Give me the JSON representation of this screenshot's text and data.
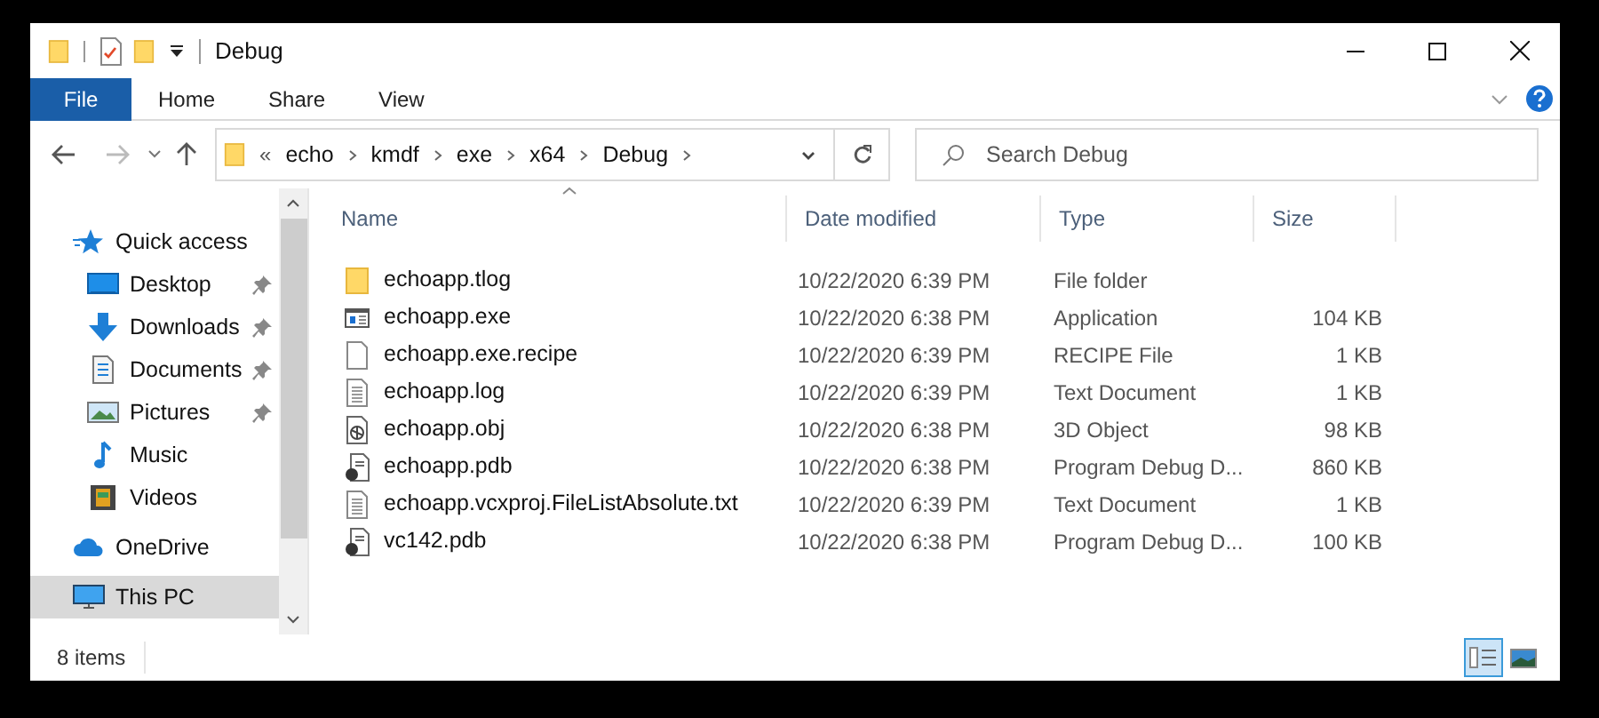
{
  "window": {
    "title": "Debug"
  },
  "ribbon": {
    "tabs": [
      {
        "label": "File",
        "selected": true
      },
      {
        "label": "Home",
        "selected": false
      },
      {
        "label": "Share",
        "selected": false
      },
      {
        "label": "View",
        "selected": false
      }
    ]
  },
  "address": {
    "overflow": "«",
    "crumbs": [
      "echo",
      "kmdf",
      "exe",
      "x64",
      "Debug"
    ]
  },
  "search": {
    "placeholder": "Search Debug"
  },
  "sidebar": {
    "items": [
      {
        "label": "Quick access",
        "kind": "star",
        "selected": false,
        "children": [
          {
            "label": "Desktop",
            "kind": "desktop",
            "pinned": true,
            "selected": false
          },
          {
            "label": "Downloads",
            "kind": "download",
            "pinned": true,
            "selected": false
          },
          {
            "label": "Documents",
            "kind": "document",
            "pinned": true,
            "selected": false
          },
          {
            "label": "Pictures",
            "kind": "picture",
            "pinned": true,
            "selected": false
          },
          {
            "label": "Music",
            "kind": "music",
            "pinned": false,
            "selected": false
          },
          {
            "label": "Videos",
            "kind": "video",
            "pinned": false,
            "selected": false
          }
        ]
      },
      {
        "label": "OneDrive",
        "kind": "cloud",
        "selected": false
      },
      {
        "label": "This PC",
        "kind": "pc",
        "selected": true
      }
    ]
  },
  "table": {
    "columns": [
      "Name",
      "Date modified",
      "Type",
      "Size"
    ],
    "rows": [
      {
        "name": "echoapp.tlog",
        "kind": "folder",
        "date": "10/22/2020 6:39 PM",
        "type": "File folder",
        "size": ""
      },
      {
        "name": "echoapp.exe",
        "kind": "exe",
        "date": "10/22/2020 6:38 PM",
        "type": "Application",
        "size": "104 KB"
      },
      {
        "name": "echoapp.exe.recipe",
        "kind": "blank",
        "date": "10/22/2020 6:39 PM",
        "type": "RECIPE File",
        "size": "1 KB"
      },
      {
        "name": "echoapp.log",
        "kind": "text",
        "date": "10/22/2020 6:39 PM",
        "type": "Text Document",
        "size": "1 KB"
      },
      {
        "name": "echoapp.obj",
        "kind": "object",
        "date": "10/22/2020 6:38 PM",
        "type": "3D Object",
        "size": "98 KB"
      },
      {
        "name": "echoapp.pdb",
        "kind": "pdb",
        "date": "10/22/2020 6:38 PM",
        "type": "Program Debug D...",
        "size": "860 KB"
      },
      {
        "name": "echoapp.vcxproj.FileListAbsolute.txt",
        "kind": "text",
        "date": "10/22/2020 6:39 PM",
        "type": "Text Document",
        "size": "1 KB"
      },
      {
        "name": "vc142.pdb",
        "kind": "pdb",
        "date": "10/22/2020 6:38 PM",
        "type": "Program Debug D...",
        "size": "100 KB"
      }
    ]
  },
  "status_bar": {
    "count": "8 items"
  },
  "views": [
    {
      "kind": "details",
      "selected": true
    },
    {
      "kind": "preview",
      "selected": false
    }
  ]
}
